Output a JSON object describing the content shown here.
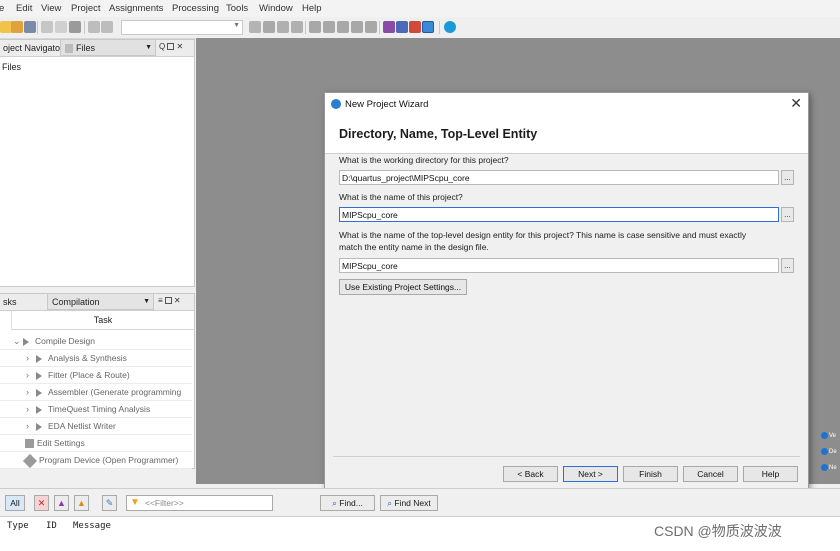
{
  "menu": [
    "e",
    "Edit",
    "View",
    "Project",
    "Assignments",
    "Processing",
    "Tools",
    "Window",
    "Help"
  ],
  "project_navigator": {
    "tab1": "oject Navigator",
    "tab2": "Files",
    "item": "Files"
  },
  "tasks": {
    "tab1": "sks",
    "flow": "Compilation",
    "col_header": "Task",
    "rows": [
      {
        "label": "Compile Design"
      },
      {
        "label": "Analysis & Synthesis"
      },
      {
        "label": "Fitter (Place & Route)"
      },
      {
        "label": "Assembler (Generate programming"
      },
      {
        "label": "TimeQuest Timing Analysis"
      },
      {
        "label": "EDA Netlist Writer"
      },
      {
        "label": "Edit Settings"
      },
      {
        "label": "Program Device (Open Programmer)"
      }
    ]
  },
  "dialog": {
    "title": "New Project Wizard",
    "heading": "Directory, Name, Top-Level Entity",
    "dir_label": "What is the working directory for this project?",
    "dir_value": "D:\\quartus_project\\MIPScpu_core",
    "name_label": "What is the name of this project?",
    "name_value": "MIPScpu_core",
    "top_label_1": "What is the name of the top-level design entity for this project? This name is case sensitive and must exactly",
    "top_label_2": "match the entity name in the design file.",
    "top_value": "MIPScpu_core",
    "browse": "...",
    "existing_btn": "Use Existing Project Settings...",
    "buttons": {
      "back": "< Back",
      "next": "Next >",
      "finish": "Finish",
      "cancel": "Cancel",
      "help": "Help"
    }
  },
  "messages": {
    "all": "All",
    "filter_placeholder": "<<Filter>>",
    "find": "Find...",
    "find_next": "Find Next",
    "columns": [
      "Type",
      "ID",
      "Message"
    ]
  },
  "side_items": [
    "Ve",
    "De",
    "Ne"
  ],
  "watermark": "CSDN @物质波波波",
  "colors": {
    "workspace": "#8d8d8d",
    "accent_blue": "#2f6ed8",
    "filter_orange": "#f0a020"
  }
}
